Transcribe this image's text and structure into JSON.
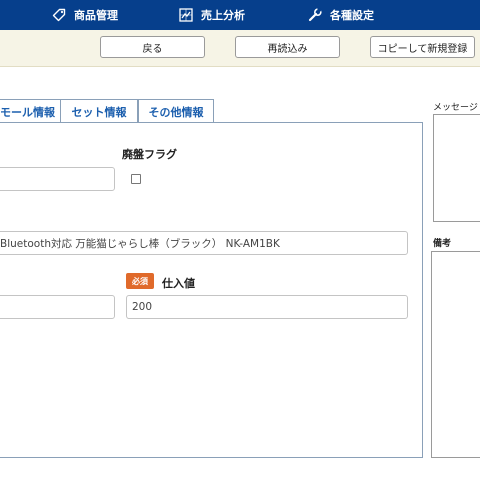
{
  "nav": {
    "products": "商品管理",
    "sales": "売上分析",
    "settings": "各種設定"
  },
  "toolbar": {
    "back": "戻る",
    "reload": "再読込み",
    "copy_new": "コピーして新規登録"
  },
  "tabs": [
    "モール情報",
    "セット情報",
    "その他情報"
  ],
  "form": {
    "discontinued_label": "廃盤フラグ",
    "product_name_value": "Bluetooth対応 万能猫じゃらし棒（ブラック） NK-AM1BK",
    "required_badge": "必須",
    "cost_label": "仕入値",
    "cost_value": "200"
  },
  "side": {
    "message_label": "メッセージ",
    "notes_label": "備考"
  },
  "colors": {
    "nav_bg": "#063f8c",
    "toolbar_bg": "#f6f4e6",
    "tab_text": "#1c5fae",
    "required_badge": "#e06a2b"
  }
}
